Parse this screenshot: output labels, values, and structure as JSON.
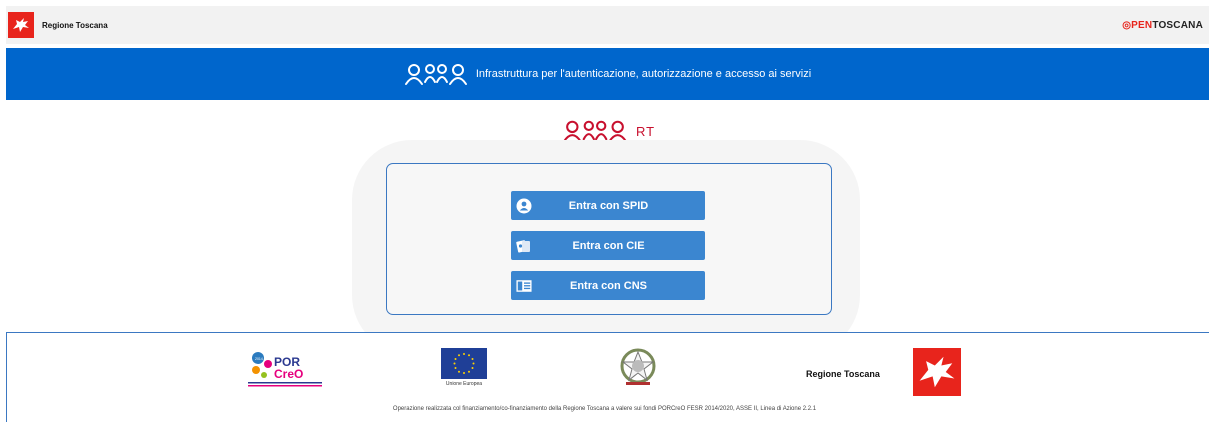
{
  "header": {
    "brand": "Regione Toscana",
    "opentoscana_prefix": "◎PEN",
    "opentoscana_suffix": "TOSCANA"
  },
  "banner": {
    "text": "Infrastruttura per l'autenticazione, autorizzazione e accesso ai servizi"
  },
  "app": {
    "rt_label": "RT"
  },
  "login": {
    "spid_label": "Entra con SPID",
    "cie_label": "Entra con CIE",
    "cns_label": "Entra con CNS"
  },
  "footer": {
    "eu_label": "Unione Europea",
    "region_label": "Regione Toscana",
    "note": "Operazione realizzata col finanziamento/co-finanziamento della Regione Toscana a valere sui fondi PORCreO FESR 2014/2020, ASSE II, Linea di Azione 2.2.1",
    "por_text1": "POR",
    "por_text2": "CreO",
    "por_years": "2014 2020"
  },
  "colors": {
    "banner_blue": "#0066cc",
    "button_blue": "#3b86d0",
    "brand_red": "#e8241c",
    "arpa_red": "#c8102e"
  }
}
